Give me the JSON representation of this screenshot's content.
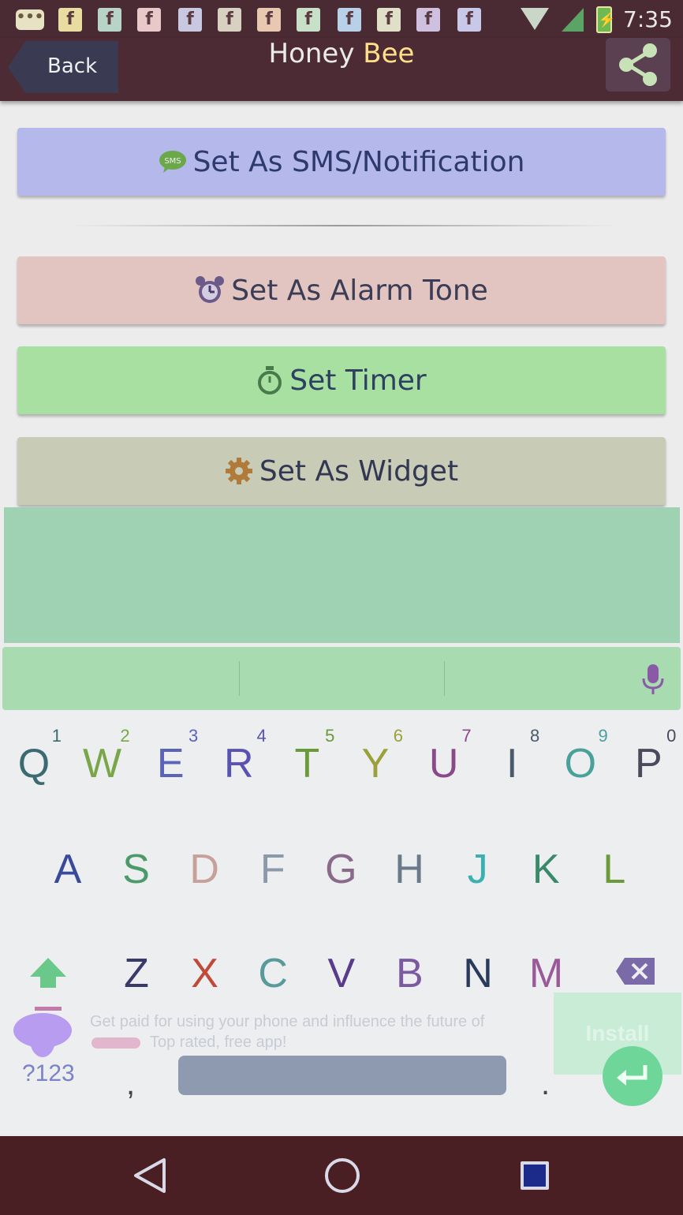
{
  "status_bar": {
    "notification_icons": [
      "message-icon",
      "facebook-icon",
      "facebook-icon",
      "facebook-icon",
      "facebook-icon",
      "facebook-icon",
      "facebook-icon",
      "facebook-icon",
      "facebook-icon",
      "facebook-icon",
      "facebook-icon",
      "facebook-icon"
    ],
    "time": "7:35"
  },
  "action_bar": {
    "back_label": "Back",
    "title_part1": "Honey",
    "title_part2": "Bee",
    "share_icon": "share-icon"
  },
  "buttons": {
    "sms": {
      "label": "Set As SMS/Notification",
      "icon": "sms-icon",
      "color": "#b4b8ea"
    },
    "alarm": {
      "label": "Set As Alarm Tone",
      "icon": "alarm-clock-icon",
      "color": "#e2c4c0"
    },
    "timer": {
      "label": "Set Timer",
      "icon": "stopwatch-icon",
      "color": "#a8e0a2"
    },
    "widget": {
      "label": "Set As Widget",
      "icon": "gear-icon",
      "color": "#c8cbb6"
    }
  },
  "keyboard": {
    "row1": [
      {
        "letter": "Q",
        "hint": "1",
        "color": "#3b6a72"
      },
      {
        "letter": "W",
        "hint": "2",
        "color": "#7aa64a"
      },
      {
        "letter": "E",
        "hint": "3",
        "color": "#5a64b8"
      },
      {
        "letter": "R",
        "hint": "4",
        "color": "#5a52b0"
      },
      {
        "letter": "T",
        "hint": "5",
        "color": "#6a9a3a"
      },
      {
        "letter": "Y",
        "hint": "6",
        "color": "#9aa03a"
      },
      {
        "letter": "U",
        "hint": "7",
        "color": "#8a4a8a"
      },
      {
        "letter": "I",
        "hint": "8",
        "color": "#4a5a6a"
      },
      {
        "letter": "O",
        "hint": "9",
        "color": "#4aa09a"
      },
      {
        "letter": "P",
        "hint": "0",
        "color": "#4a4a5a"
      }
    ],
    "row2": [
      {
        "letter": "A",
        "color": "#3a4a9a"
      },
      {
        "letter": "S",
        "color": "#4a9a6a"
      },
      {
        "letter": "D",
        "color": "#c8a09a"
      },
      {
        "letter": "F",
        "color": "#8a9aaa"
      },
      {
        "letter": "G",
        "color": "#8a6a8a"
      },
      {
        "letter": "H",
        "color": "#6a7a8a"
      },
      {
        "letter": "J",
        "color": "#3ab0b0"
      },
      {
        "letter": "K",
        "color": "#3a8a6a"
      },
      {
        "letter": "L",
        "color": "#6a9a3a"
      }
    ],
    "row3": [
      {
        "letter": "Z",
        "color": "#3a3a6a"
      },
      {
        "letter": "X",
        "color": "#c04a3a"
      },
      {
        "letter": "C",
        "color": "#5a9a9a"
      },
      {
        "letter": "V",
        "color": "#5a3a8a"
      },
      {
        "letter": "B",
        "color": "#7a5aa0"
      },
      {
        "letter": "N",
        "color": "#2a3a5a"
      },
      {
        "letter": "M",
        "color": "#9a5a9a"
      }
    ],
    "sym_label": "?123",
    "comma": ",",
    "period": ".",
    "shift_icon": "shift-arrow-icon",
    "backspace_icon": "backspace-icon",
    "enter_icon": "enter-arrow-icon",
    "mic_icon": "microphone-icon"
  },
  "ad": {
    "line1": "Get paid for using your phone and influence the future of",
    "line2": "Top rated, free app!",
    "install_label": "Install"
  },
  "nav": {
    "back": "triangle-back-icon",
    "home": "circle-home-icon",
    "recents": "square-recents-icon"
  }
}
